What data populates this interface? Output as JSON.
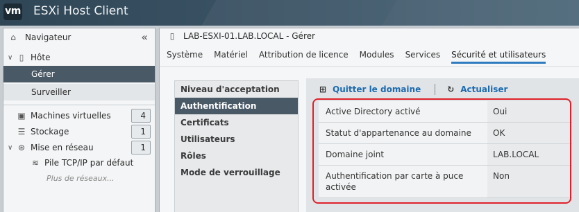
{
  "app": {
    "logo": "vm",
    "title": "ESXi Host Client"
  },
  "navigator": {
    "title": "Navigateur",
    "host": {
      "label": "Hôte",
      "children": [
        "Gérer",
        "Surveiller"
      ]
    },
    "items": [
      {
        "label": "Machines virtuelles",
        "count": "4"
      },
      {
        "label": "Stockage",
        "count": "1"
      },
      {
        "label": "Mise en réseau",
        "count": "1"
      }
    ],
    "network_child": "Pile TCP/IP par défaut",
    "more": "Plus de réseaux..."
  },
  "main": {
    "title": "LAB-ESXI-01.LAB.LOCAL - Gérer",
    "tabs": [
      "Système",
      "Matériel",
      "Attribution de licence",
      "Modules",
      "Services",
      "Sécurité et utilisateurs"
    ],
    "active_tab": "Sécurité et utilisateurs"
  },
  "security_menu": [
    "Niveau d'acceptation",
    "Authentification",
    "Certificats",
    "Utilisateurs",
    "Rôles",
    "Mode de verrouillage"
  ],
  "toolbar": {
    "leave_domain": "Quitter le domaine",
    "refresh": "Actualiser"
  },
  "auth_table": [
    {
      "key": "Active Directory activé",
      "value": "Oui"
    },
    {
      "key": "Statut d'appartenance au domaine",
      "value": "OK"
    },
    {
      "key": "Domaine joint",
      "value": "LAB.LOCAL"
    },
    {
      "key": "Authentification par carte à puce activée",
      "value": "Non"
    }
  ],
  "colors": {
    "accent": "#2f7bbf",
    "selected": "#4a5966",
    "highlight": "#e0202a"
  }
}
